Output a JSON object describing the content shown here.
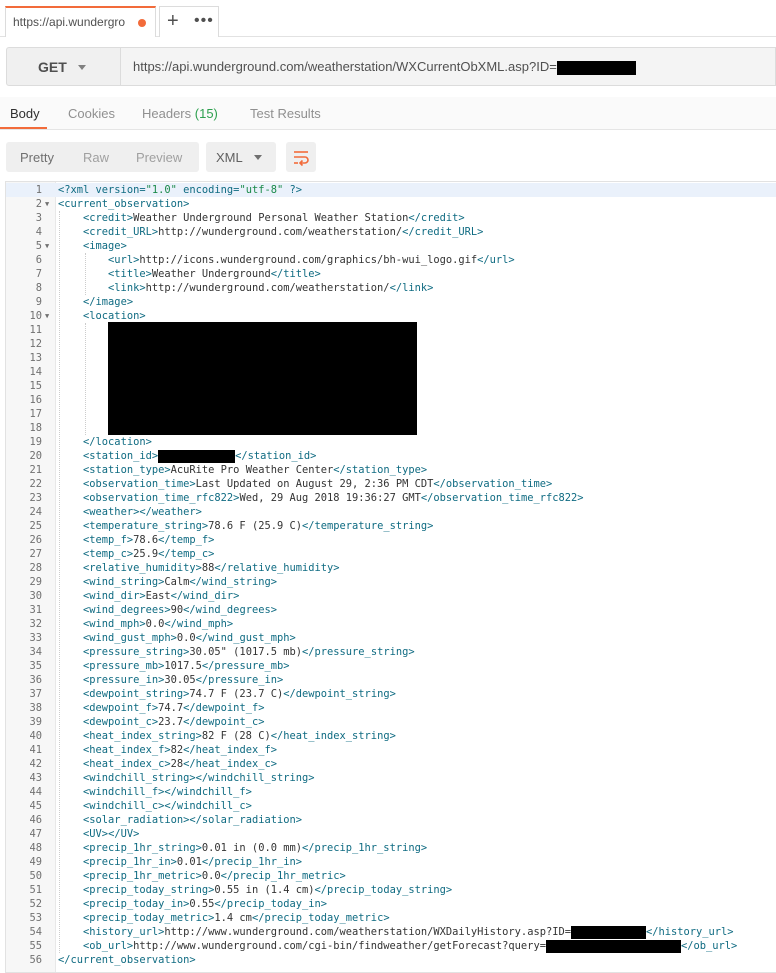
{
  "tab": {
    "title": "https://api.wundergro"
  },
  "tab_actions": {
    "new_tab": "+",
    "more": "•••"
  },
  "request": {
    "method": "GET",
    "url": "https://api.wunderground.com/weatherstation/WXCurrentObXML.asp?ID="
  },
  "response_tabs": {
    "body": "Body",
    "cookies": "Cookies",
    "headers": "Headers",
    "headers_count": "(15)",
    "tests": "Test Results"
  },
  "view_modes": {
    "pretty": "Pretty",
    "raw": "Raw",
    "preview": "Preview"
  },
  "format": {
    "selected": "XML"
  },
  "colors": {
    "accent": "#f26b3a",
    "tag": "#0f6b82",
    "string": "#1a8a4a",
    "active_line": "#eaf1fb"
  },
  "editor": {
    "active_line": 1,
    "lines": [
      "<?xml version=\"1.0\" encoding=\"utf-8\" ?>",
      "<current_observation>",
      "    <credit>Weather Underground Personal Weather Station</credit>",
      "    <credit_URL>http://wunderground.com/weatherstation/</credit_URL>",
      "    <image>",
      "        <url>http://icons.wunderground.com/graphics/bh-wui_logo.gif</url>",
      "        <title>Weather Underground</title>",
      "        <link>http://wunderground.com/weatherstation/</link>",
      "    </image>",
      "    <location>",
      "",
      "",
      "",
      "",
      "",
      "",
      "",
      "",
      "    </location>",
      "    <station_id>",
      "    <station_type>AcuRite Pro Weather Center</station_type>",
      "    <observation_time>Last Updated on August 29, 2:36 PM CDT</observation_time>",
      "    <observation_time_rfc822>Wed, 29 Aug 2018 19:36:27 GMT</observation_time_rfc822>",
      "    <weather></weather>",
      "    <temperature_string>78.6 F (25.9 C)</temperature_string>",
      "    <temp_f>78.6</temp_f>",
      "    <temp_c>25.9</temp_c>",
      "    <relative_humidity>88</relative_humidity>",
      "    <wind_string>Calm</wind_string>",
      "    <wind_dir>East</wind_dir>",
      "    <wind_degrees>90</wind_degrees>",
      "    <wind_mph>0.0</wind_mph>",
      "    <wind_gust_mph>0.0</wind_gust_mph>",
      "    <pressure_string>30.05\" (1017.5 mb)</pressure_string>",
      "    <pressure_mb>1017.5</pressure_mb>",
      "    <pressure_in>30.05</pressure_in>",
      "    <dewpoint_string>74.7 F (23.7 C)</dewpoint_string>",
      "    <dewpoint_f>74.7</dewpoint_f>",
      "    <dewpoint_c>23.7</dewpoint_c>",
      "    <heat_index_string>82 F (28 C)</heat_index_string>",
      "    <heat_index_f>82</heat_index_f>",
      "    <heat_index_c>28</heat_index_c>",
      "    <windchill_string></windchill_string>",
      "    <windchill_f></windchill_f>",
      "    <windchill_c></windchill_c>",
      "    <solar_radiation></solar_radiation>",
      "    <UV></UV>",
      "    <precip_1hr_string>0.01 in (0.0 mm)</precip_1hr_string>",
      "    <precip_1hr_in>0.01</precip_1hr_in>",
      "    <precip_1hr_metric>0.0</precip_1hr_metric>",
      "    <precip_today_string>0.55 in (1.4 cm)</precip_today_string>",
      "    <precip_today_in>0.55</precip_today_in>",
      "    <precip_today_metric>1.4 cm</precip_today_metric>",
      "    <history_url>http://www.wunderground.com/weatherstation/WXDailyHistory.asp?ID=",
      "    <ob_url>http://www.wunderground.com/cgi-bin/findweather/getForecast?query=",
      "</current_observation>"
    ],
    "line_tails": {
      "20": "</station_id>",
      "54": "</history_url>",
      "55": "</ob_url>"
    },
    "fold_lines": [
      2,
      5,
      10
    ]
  }
}
